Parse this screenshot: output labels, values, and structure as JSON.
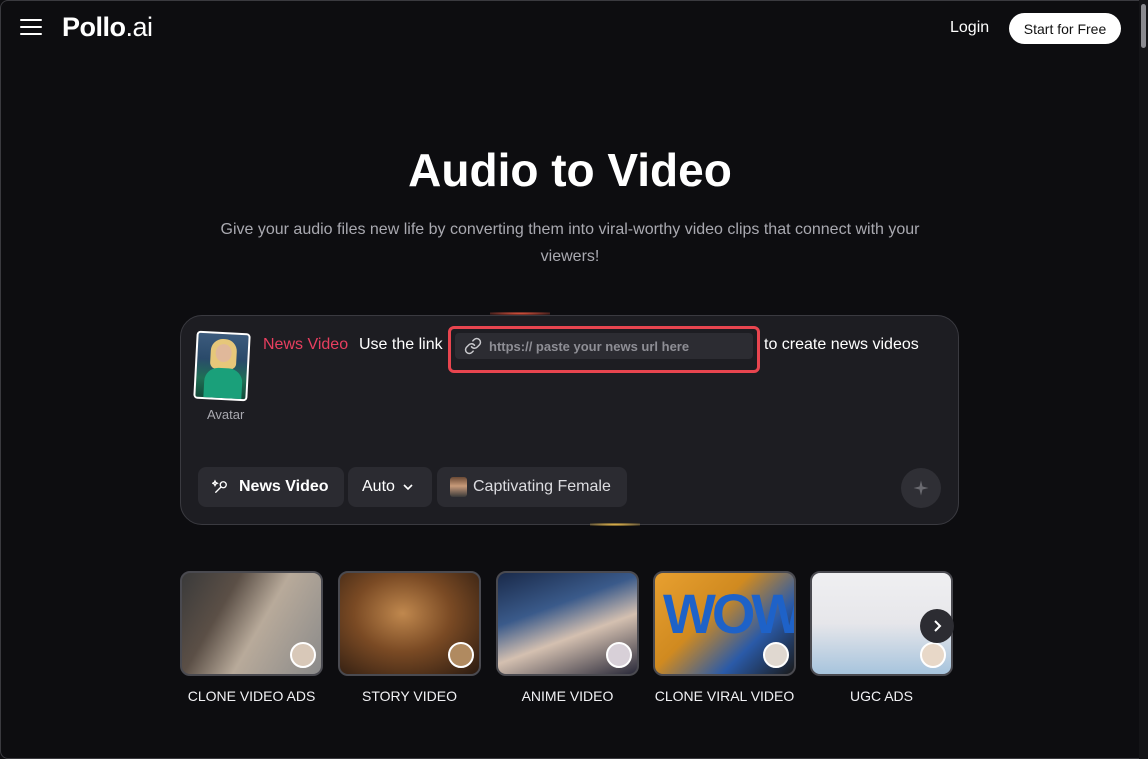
{
  "header": {
    "logo_main": "Pollo",
    "logo_suffix": ".ai",
    "login_label": "Login",
    "start_label": "Start for Free"
  },
  "hero": {
    "title": "Audio to Video",
    "subtitle": "Give your audio files new life by converting them into viral-worthy video clips that connect with your viewers!"
  },
  "composer": {
    "avatar_label": "Avatar",
    "mode": "News Video",
    "prompt_pre": "Use the link",
    "url_placeholder": "https:// paste your news url here",
    "url_value": "",
    "prompt_post": "to create news videos",
    "chips": {
      "news_video": "News Video",
      "auto": "Auto",
      "voice": "Captivating Female"
    },
    "highlight_color": "#e8454f",
    "mode_color": "#e83f5f"
  },
  "templates": [
    {
      "label": "CLONE VIDEO ADS"
    },
    {
      "label": "STORY VIDEO"
    },
    {
      "label": "ANIME VIDEO"
    },
    {
      "label": "CLONE VIRAL VIDEO"
    },
    {
      "label": "UGC ADS"
    }
  ],
  "template_overlays": {
    "wow_text": "WOW"
  }
}
